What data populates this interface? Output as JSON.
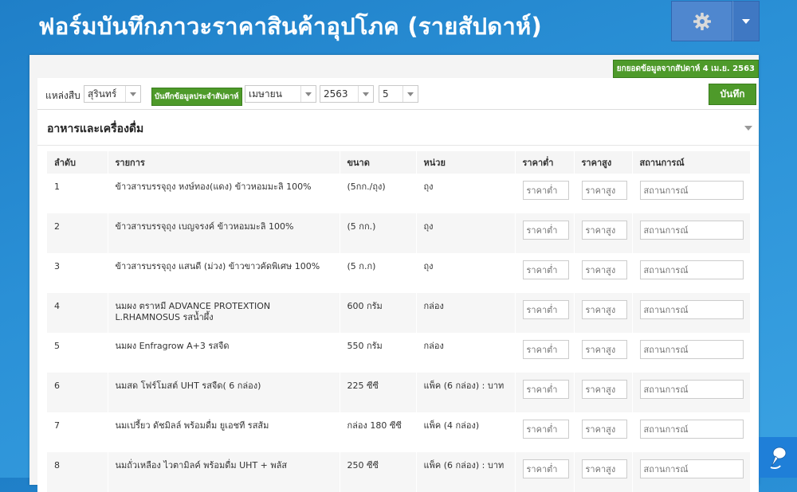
{
  "header": {
    "title": "ฟอร์มบันทึกภาวะราคาสินค้าอุปโภค (รายสัปดาห์)"
  },
  "badge": "ยกยอดข้อมูลจากสัปดาห์ 4 เม.ย. 2563",
  "filters": {
    "source_label": "แหล่งสืบ",
    "source_value": "สุรินทร์",
    "weekly_tag": "บันทึกข้อมูลประจำสัปดาห์",
    "month_value": "เมษายน",
    "year_value": "2563",
    "week_value": "5",
    "save_label": "บันทึก"
  },
  "section": {
    "title": "อาหารและเครื่องดื่ม"
  },
  "table": {
    "headers": [
      "ลำดับ",
      "รายการ",
      "ขนาด",
      "หน่วย",
      "ราคาต่ำ",
      "ราคาสูง",
      "สถานการณ์"
    ],
    "placeholders": {
      "low": "ราคาต่ำ",
      "high": "ราคาสูง",
      "status": "สถานการณ์"
    },
    "rows": [
      {
        "no": "1",
        "item": "ข้าวสารบรรจุถุง หงษ์ทอง(แดง) ข้าวหอมมะลิ 100%",
        "size": "(5กก./ถุง)",
        "unit": "ถุง"
      },
      {
        "no": "2",
        "item": "ข้าวสารบรรจุถุง เบญจรงค์ ข้าวหอมมะลิ 100%",
        "size": "(5 กก.)",
        "unit": "ถุง"
      },
      {
        "no": "3",
        "item": "ข้าวสารบรรจุถุง แสนดี (ม่วง) ข้าวขาวคัดพิเศษ 100%",
        "size": "(5 ก.ก)",
        "unit": "ถุง"
      },
      {
        "no": "4",
        "item": "นมผง ตราหมี ADVANCE PROTEXTION L.RHAMNOSUS รสน้ำผึ้ง",
        "size": "600 กรัม",
        "unit": "กล่อง"
      },
      {
        "no": "5",
        "item": "นมผง Enfragrow A+3 รสจืด",
        "size": "550 กรัม",
        "unit": "กล่อง"
      },
      {
        "no": "6",
        "item": "นมสด โฟร์โมสต์ UHT รสจืด( 6 กล่อง)",
        "size": "225 ซีซี",
        "unit": "แพ็ค (6 กล่อง) : บาท"
      },
      {
        "no": "7",
        "item": "นมเปรี้ยว ดัชมิลล์ พร้อมดื่ม ยูเอชที รสส้ม",
        "size": "กล่อง 180 ซีซี",
        "unit": "แพ็ค (4 กล่อง)"
      },
      {
        "no": "8",
        "item": "นมถั่วเหลือง ไวตามิลค์ พร้อมดื่ม UHT + พลัส",
        "size": "250 ซีซี",
        "unit": "แพ็ค (6 กล่อง) : บาท"
      }
    ]
  }
}
